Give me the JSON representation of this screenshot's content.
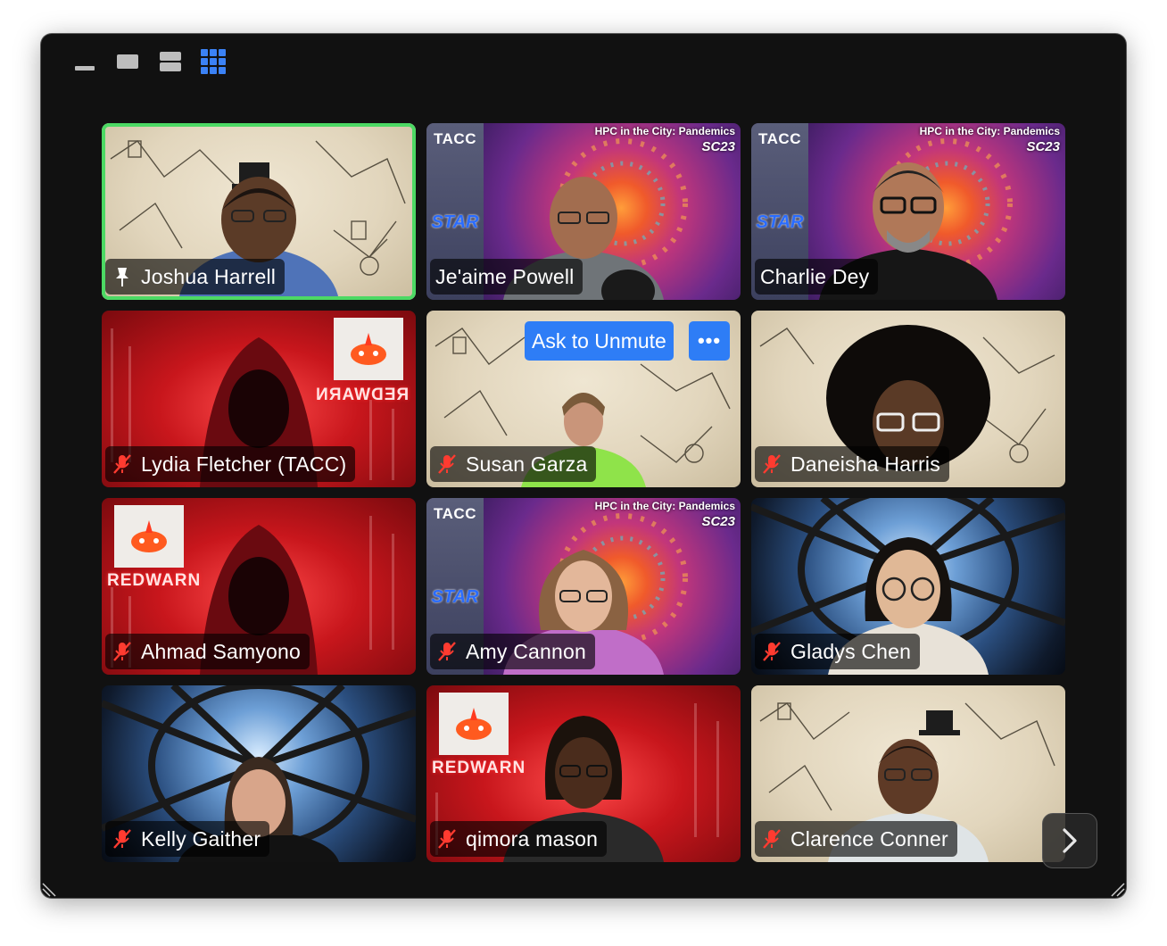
{
  "toolbar": {
    "buttons": [
      "minimize-view",
      "speaker-view",
      "gallery-strip-view",
      "gallery-view"
    ],
    "active": "gallery-view",
    "active_color": "#3b82f6"
  },
  "active_speaker_color": "#4cd964",
  "participants": [
    {
      "name": "Joshua Harrell",
      "background": "parchment",
      "status": "pinned-host",
      "speaking": true
    },
    {
      "name": "Je'aime Powell",
      "background": "sc23-pandemics",
      "status": "unmuted"
    },
    {
      "name": "Charlie Dey",
      "background": "sc23-pandemics",
      "status": "unmuted"
    },
    {
      "name": "Lydia Fletcher (TACC)",
      "background": "redwarn",
      "status": "muted"
    },
    {
      "name": "Susan Garza",
      "background": "parchment",
      "status": "muted"
    },
    {
      "name": "Daneisha Harris",
      "background": "parchment",
      "status": "muted"
    },
    {
      "name": "Ahmad Samyono",
      "background": "redwarn",
      "status": "muted"
    },
    {
      "name": "Amy Cannon",
      "background": "sc23-pandemics",
      "status": "muted"
    },
    {
      "name": "Gladys Chen",
      "background": "hyperspace",
      "status": "muted"
    },
    {
      "name": "Kelly Gaither",
      "background": "hyperspace",
      "status": "muted"
    },
    {
      "name": "qimora mason",
      "background": "redwarn",
      "status": "muted"
    },
    {
      "name": "Clarence Conner",
      "background": "parchment",
      "status": "muted"
    }
  ],
  "hover_menu": {
    "ask_to_unmute": "Ask to Unmute",
    "more": "•••"
  },
  "backgrounds": {
    "sc23": {
      "title": "HPC in the City: Pandemics",
      "badge": "SC23",
      "logos": [
        "TACC",
        "STAR"
      ]
    },
    "redwarn": {
      "logo_text": "REDWARN",
      "mirrored_text": "REDWARN"
    }
  },
  "mic_muted_color": "#ff3b30"
}
